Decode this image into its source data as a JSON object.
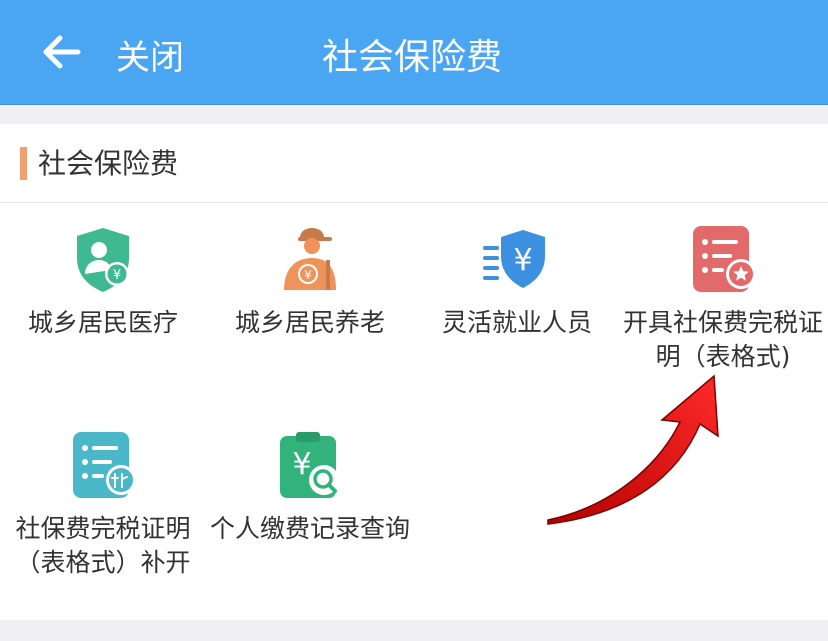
{
  "header": {
    "back_label": "关闭",
    "title": "社会保险费"
  },
  "section": {
    "title": "社会保险费"
  },
  "services": [
    {
      "label": "城乡居民医疗",
      "icon": "shield-person-yuan-icon",
      "color": "#3fb98f"
    },
    {
      "label": "城乡居民养老",
      "icon": "elderly-person-yuan-icon",
      "color": "#f0935a"
    },
    {
      "label": "灵活就业人员",
      "icon": "shield-yuan-icon",
      "color": "#3d8fe0"
    },
    {
      "label": "开具社保费完税证明（表格式)",
      "icon": "document-star-icon",
      "color": "#e26a6a"
    },
    {
      "label": "社保费完税证明（表格式）补开",
      "icon": "document-supplement-icon",
      "color": "#4bb8c9"
    },
    {
      "label": "个人缴费记录查询",
      "icon": "clipboard-yuan-search-icon",
      "color": "#33b37c"
    }
  ],
  "colors": {
    "header_bg": "#4aa6f3",
    "section_accent": "#f0a06e",
    "annotation_arrow": "#e8141b"
  }
}
